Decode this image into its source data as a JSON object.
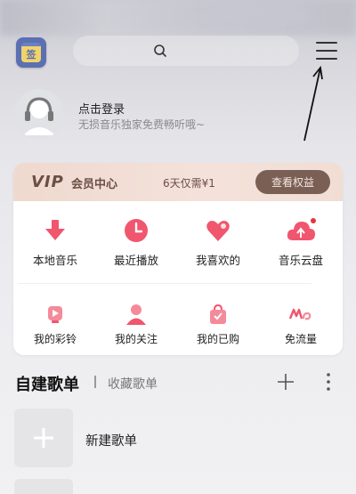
{
  "header": {
    "app_icon_glyph": "签",
    "search_icon": "search-icon",
    "menu_icon": "hamburger-menu-icon"
  },
  "user": {
    "login_title": "点击登录",
    "login_subtitle": "无损音乐独家免费畅听哦~"
  },
  "vip": {
    "logo": "VIP",
    "center_label": "会员中心",
    "price_text": "6天仅需¥1",
    "button_label": "查看权益"
  },
  "shortcuts_row1": [
    {
      "label": "本地音乐",
      "icon": "download-arrow-icon"
    },
    {
      "label": "最近播放",
      "icon": "clock-icon"
    },
    {
      "label": "我喜欢的",
      "icon": "heart-icon"
    },
    {
      "label": "音乐云盘",
      "icon": "cloud-upload-icon"
    }
  ],
  "shortcuts_row2": [
    {
      "label": "我的彩铃",
      "icon": "bell-icon"
    },
    {
      "label": "我的关注",
      "icon": "person-icon"
    },
    {
      "label": "我的已购",
      "icon": "shopping-bag-icon"
    },
    {
      "label": "免流量",
      "icon": "free-data-icon"
    }
  ],
  "playlists": {
    "title": "自建歌单",
    "tab_collected": "收藏歌单",
    "new_playlist_label": "新建歌单"
  },
  "colors": {
    "accent_pink": "#f0566e",
    "vip_brown": "#7a5f55"
  }
}
